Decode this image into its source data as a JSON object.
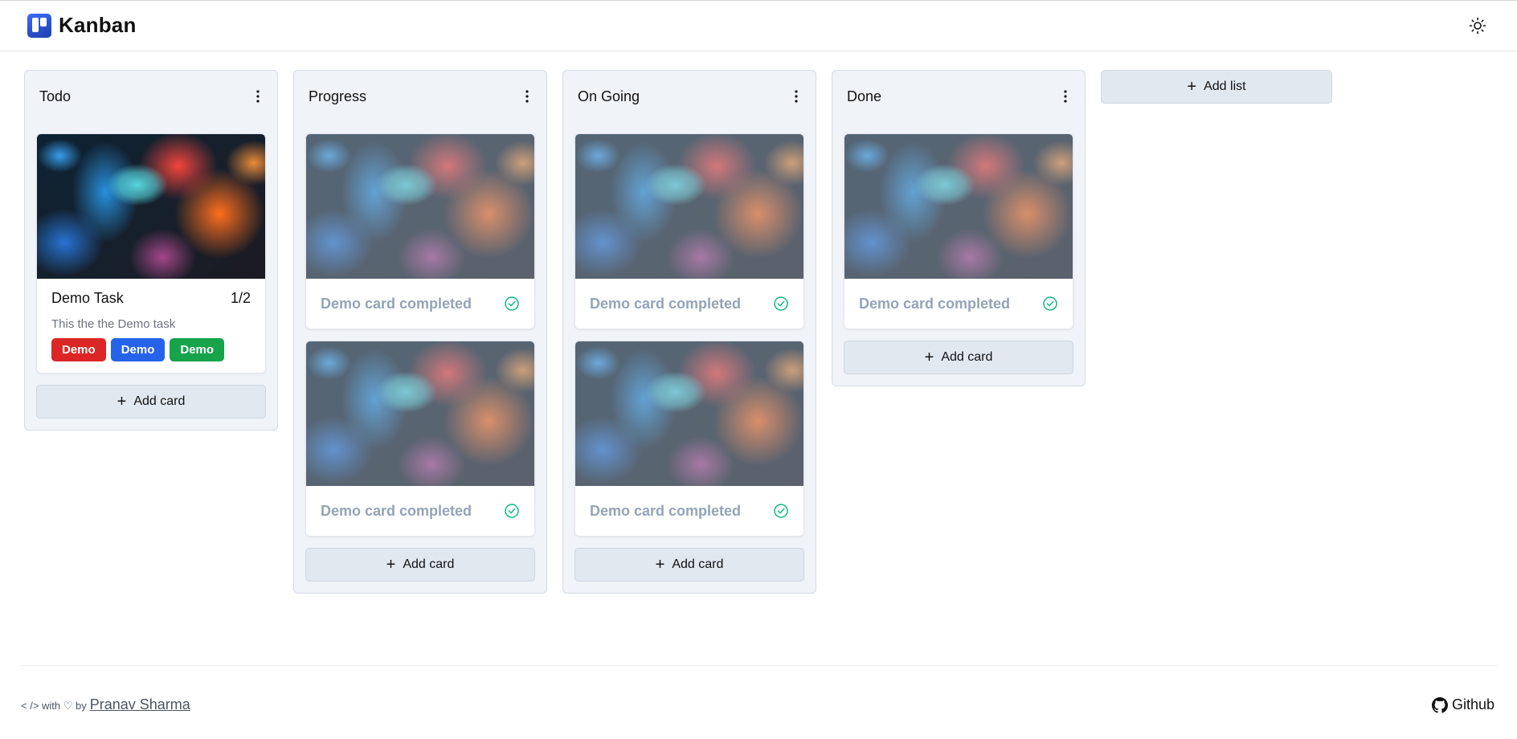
{
  "app": {
    "title": "Kanban"
  },
  "header": {
    "theme_toggle_icon": "sun-icon"
  },
  "lists": [
    {
      "title": "Todo",
      "cards": [
        {
          "type": "task",
          "title": "Demo Task",
          "count": "1/2",
          "description": "This the the Demo task",
          "tags": [
            {
              "label": "Demo",
              "color": "#dc2626"
            },
            {
              "label": "Demo",
              "color": "#2563eb"
            },
            {
              "label": "Demo",
              "color": "#16a34a"
            }
          ]
        }
      ],
      "add_label": "Add card"
    },
    {
      "title": "Progress",
      "cards": [
        {
          "type": "completed",
          "title": "Demo card completed"
        },
        {
          "type": "completed",
          "title": "Demo card completed"
        }
      ],
      "add_label": "Add card"
    },
    {
      "title": "On Going",
      "cards": [
        {
          "type": "completed",
          "title": "Demo card completed"
        },
        {
          "type": "completed",
          "title": "Demo card completed"
        }
      ],
      "add_label": "Add card"
    },
    {
      "title": "Done",
      "cards": [
        {
          "type": "completed",
          "title": "Demo card completed"
        }
      ],
      "add_label": "Add card"
    }
  ],
  "add_list_label": "Add list",
  "colors": {
    "check": "#10b981",
    "completed_text": "#94a3b8"
  },
  "footer": {
    "prefix": "< /> with ♡ by",
    "author": "Pranav Sharma",
    "github_label": "Github"
  }
}
